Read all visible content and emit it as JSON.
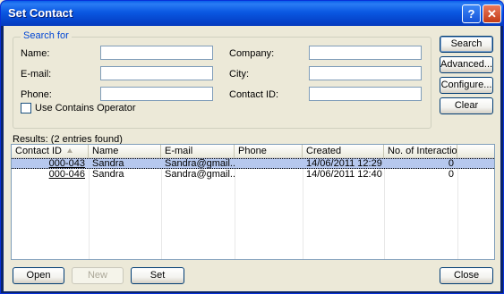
{
  "window": {
    "title": "Set Contact",
    "help_label": "?",
    "close_label": "✕"
  },
  "search": {
    "legend": "Search for",
    "name_label": "Name:",
    "name_value": "",
    "email_label": "E-mail:",
    "email_value": "",
    "phone_label": "Phone:",
    "phone_value": "",
    "company_label": "Company:",
    "company_value": "",
    "city_label": "City:",
    "city_value": "",
    "contact_id_label": "Contact ID:",
    "contact_id_value": "",
    "contains_operator_label": "Use Contains Operator",
    "contains_operator_checked": false
  },
  "side_buttons": {
    "search": "Search",
    "advanced": "Advanced...",
    "configure": "Configure...",
    "clear": "Clear"
  },
  "results": {
    "label": "Results:  (2 entries found)",
    "columns": [
      "Contact ID",
      "Name",
      "E-mail",
      "Phone",
      "Created",
      "No. of Interactio..."
    ],
    "rows": [
      {
        "contact_id": "000-043",
        "name": "Sandra",
        "email": "Sandra@gmail....",
        "phone": "",
        "created": "14/06/2011 12:29",
        "interactions": "0"
      },
      {
        "contact_id": "000-046",
        "name": "Sandra",
        "email": "Sandra@gmail....",
        "phone": "",
        "created": "14/06/2011 12:40",
        "interactions": "0"
      }
    ]
  },
  "bottom_buttons": {
    "open": "Open",
    "new": "New",
    "set": "Set",
    "close": "Close"
  }
}
